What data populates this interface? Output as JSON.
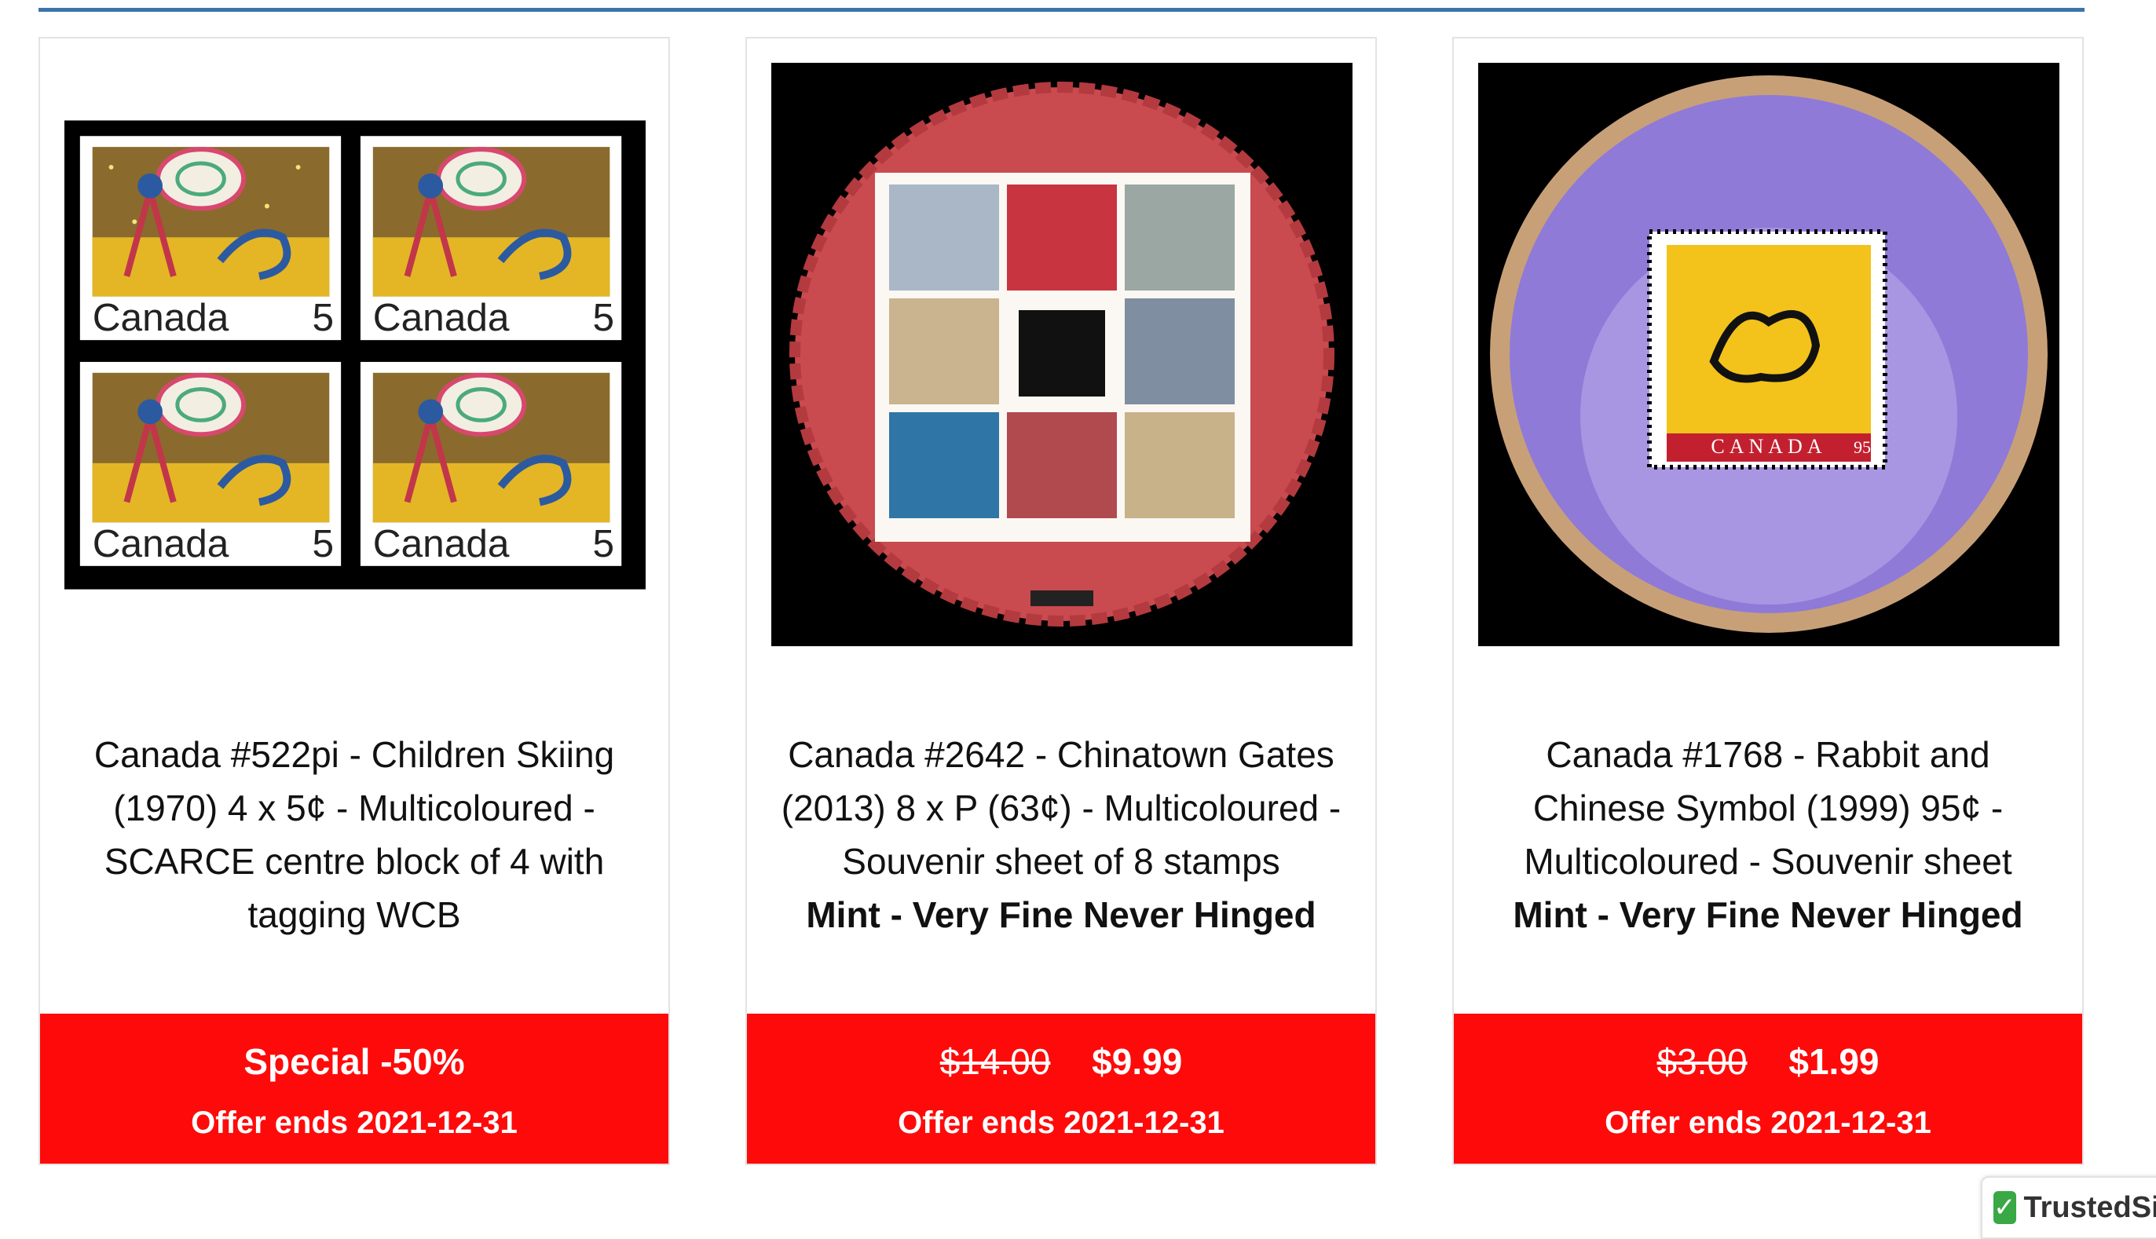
{
  "products": [
    {
      "title": "Canada #522pi - Children Skiing (1970) 4 x 5¢ - Multicoloured - SCARCE centre block of 4 with tagging WCB",
      "condition": "",
      "old_price": "",
      "price": "Special -50%",
      "offer": "Offer ends 2021-12-31",
      "image_alt": "Canada Christmas 5¢ block of 4"
    },
    {
      "title": "Canada #2642 - Chinatown Gates (2013) 8 x P (63¢) - Multicoloured - Souvenir sheet of 8 stamps",
      "condition": "Mint - Very Fine Never Hinged",
      "old_price": "$14.00",
      "price": "$9.99",
      "offer": "Offer ends 2021-12-31",
      "image_alt": "Chinatown Gates souvenir sheet"
    },
    {
      "title": "Canada #1768 - Rabbit and Chinese Symbol (1999) 95¢ - Multicoloured - Souvenir sheet",
      "condition": "Mint - Very Fine Never Hinged",
      "old_price": "$3.00",
      "price": "$1.99",
      "offer": "Offer ends 2021-12-31",
      "image_alt": "Year of the Rabbit souvenir sheet"
    }
  ],
  "stamp_text": {
    "country": "Canada",
    "denomination": "5",
    "sheet_country": "CANADA",
    "sheet_value": "95"
  },
  "trusted_badge": {
    "label": "TrustedSite"
  },
  "colors": {
    "accent_rule": "#3d73a9",
    "price_bg": "#ff0a0a",
    "badge_green": "#39a845"
  }
}
